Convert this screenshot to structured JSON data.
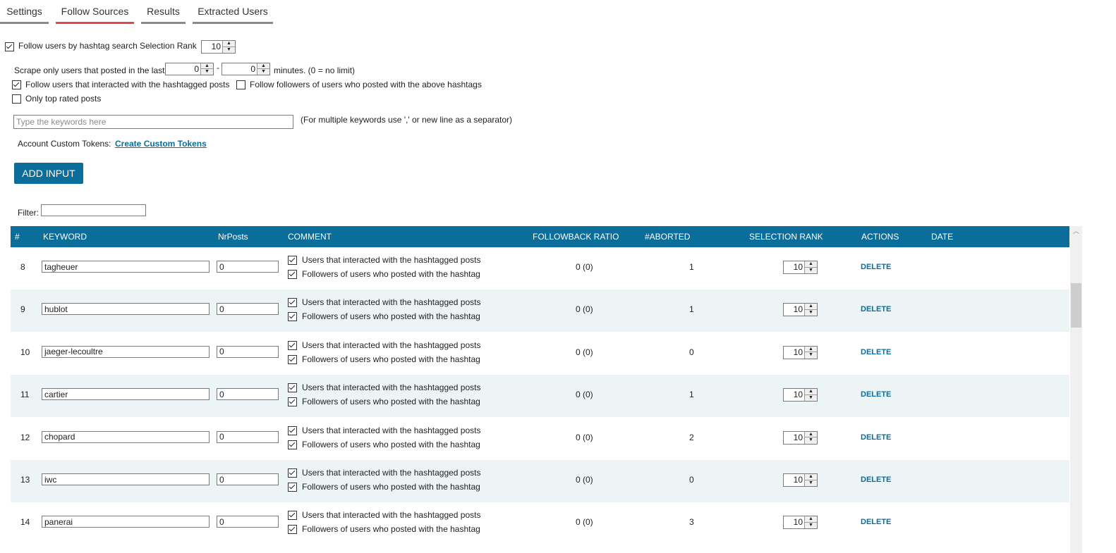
{
  "tabs": [
    {
      "label": "Settings"
    },
    {
      "label": "Follow Sources"
    },
    {
      "label": "Results"
    },
    {
      "label": "Extracted Users"
    }
  ],
  "form": {
    "follow_hashtag_label": "Follow users by hashtag search",
    "follow_hashtag_checked": true,
    "selection_rank_label": "Selection Rank",
    "selection_rank_value": "10",
    "scrape_label": "Scrape only users that posted in the last",
    "scrape_min": "0",
    "dash": "-",
    "scrape_max": "0",
    "minutes_label": "minutes. (0 = no limit)",
    "interacted_label": "Follow users that interacted with the hashtagged posts",
    "interacted_checked": true,
    "followers_label": "Follow followers of users who posted with the above hashtags",
    "followers_checked": false,
    "top_rated_label": "Only top rated posts",
    "top_rated_checked": false,
    "keywords_placeholder": "Type the keywords here",
    "keywords_hint": "(For multiple keywords use ',' or new line as a separator)",
    "tokens_label": "Account Custom Tokens:",
    "tokens_link": "Create Custom Tokens",
    "add_input": "ADD INPUT",
    "filter_label": "Filter:",
    "filter_value": ""
  },
  "table": {
    "headers": {
      "num": "#",
      "keyword": "KEYWORD",
      "nrposts": "NrPosts",
      "comment": "COMMENT",
      "ratio": "FOLLOWBACK RATIO",
      "aborted": "#ABORTED",
      "rank": "SELECTION RANK",
      "actions": "ACTIONS",
      "date": "DATE"
    },
    "comment_a": "Users that interacted with the hashtagged posts",
    "comment_b": "Followers of users who posted with the hashtag",
    "delete_label": "DELETE",
    "rows": [
      {
        "num": "8",
        "keyword": "tagheuer",
        "nrposts": "0",
        "ratio": "0 (0)",
        "aborted": "1",
        "rank": "10",
        "date": ""
      },
      {
        "num": "9",
        "keyword": "hublot",
        "nrposts": "0",
        "ratio": "0 (0)",
        "aborted": "1",
        "rank": "10",
        "date": ""
      },
      {
        "num": "10",
        "keyword": "jaeger-lecoultre",
        "nrposts": "0",
        "ratio": "0 (0)",
        "aborted": "0",
        "rank": "10",
        "date": ""
      },
      {
        "num": "11",
        "keyword": "cartier",
        "nrposts": "0",
        "ratio": "0 (0)",
        "aborted": "1",
        "rank": "10",
        "date": ""
      },
      {
        "num": "12",
        "keyword": "chopard",
        "nrposts": "0",
        "ratio": "0 (0)",
        "aborted": "2",
        "rank": "10",
        "date": ""
      },
      {
        "num": "13",
        "keyword": "iwc",
        "nrposts": "0",
        "ratio": "0 (0)",
        "aborted": "0",
        "rank": "10",
        "date": ""
      },
      {
        "num": "14",
        "keyword": "panerai",
        "nrposts": "0",
        "ratio": "0 (0)",
        "aborted": "3",
        "rank": "10",
        "date": ""
      }
    ]
  },
  "colors": {
    "accent": "#0b6d9a",
    "active_tab": "#e0464b",
    "tab_bar": "#8a8a8a",
    "row_alt": "#edf4f6"
  }
}
